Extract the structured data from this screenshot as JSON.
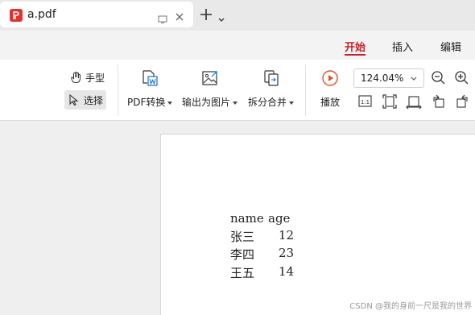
{
  "tab": {
    "title": "a.pdf"
  },
  "ribbon": {
    "tabs": [
      {
        "label": "开始",
        "active": true
      },
      {
        "label": "插入",
        "active": false
      },
      {
        "label": "编辑",
        "active": false
      }
    ]
  },
  "toolbar": {
    "hand_label": "手型",
    "select_label": "选择",
    "pdf_convert_label": "PDF转换",
    "export_image_label": "输出为图片",
    "split_merge_label": "拆分合并",
    "play_label": "播放",
    "zoom_value": "124.04%"
  },
  "document": {
    "header": [
      "name",
      "age"
    ],
    "rows": [
      [
        "张三",
        "12"
      ],
      [
        "李四",
        "23"
      ],
      [
        "王五",
        "14"
      ]
    ]
  },
  "watermark": "CSDN @我的身前一尺是我的世界",
  "colors": {
    "accent": "#c8202c",
    "pdf_icon": "#e2322c",
    "play_icon": "#e0502a"
  }
}
